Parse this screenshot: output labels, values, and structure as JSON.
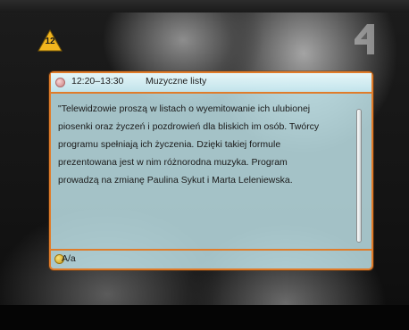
{
  "rating_badge": {
    "label": "12",
    "color": "#f2b51e"
  },
  "channel_logo": {
    "icon": "tv4-logo-icon"
  },
  "epg": {
    "time": "12:20–13:30",
    "title": "Muzyczne listy",
    "description_lines": [
      "\"Telewidzowie proszą w listach o wyemitowanie ich ulubionej",
      "piosenki oraz życzeń i pozdrowień dla bliskich im osób. Twórcy",
      " programu spełniają ich życzenia. Dzięki takiej formule",
      "prezentowana jest w nim różnorodna muzyka. Program",
      "prowadzą na zmianę Paulina Sykut i Marta Leleniewska."
    ],
    "footer_key_label": "A/a",
    "colors": {
      "border": "#e07c2a",
      "panel": "#c8eef4",
      "key_yellow": "#e8bf2a"
    }
  }
}
